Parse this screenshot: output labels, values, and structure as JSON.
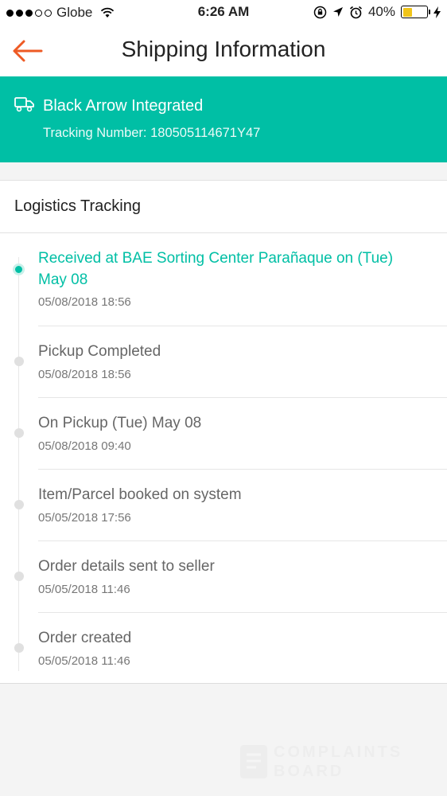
{
  "status_bar": {
    "carrier": "Globe",
    "time": "6:26 AM",
    "battery": "40%",
    "battery_level": 0.4,
    "signal_full": 3,
    "signal_total": 5
  },
  "header": {
    "title": "Shipping Information",
    "back_icon": "arrow-left-icon",
    "accent_color": "#ee5a24"
  },
  "carrier": {
    "name": "Black Arrow Integrated",
    "tracking_label": "Tracking Number: 180505114671Y47",
    "icon": "truck-icon",
    "banner_color": "#00bfa5"
  },
  "logistics": {
    "title": "Logistics Tracking",
    "events": [
      {
        "text": "Received at BAE Sorting Center Parañaque on (Tue) May 08",
        "time": "05/08/2018 18:56",
        "current": true
      },
      {
        "text": "Pickup Completed",
        "time": "05/08/2018 18:56"
      },
      {
        "text": "On Pickup (Tue) May 08",
        "time": "05/08/2018 09:40"
      },
      {
        "text": "Item/Parcel booked on system",
        "time": "05/05/2018 17:56"
      },
      {
        "text": "Order details sent to seller",
        "time": "05/05/2018 11:46"
      },
      {
        "text": "Order created",
        "time": "05/05/2018 11:46"
      }
    ]
  },
  "watermark": {
    "line1": "COMPLAINTS",
    "line2": "BOARD"
  }
}
